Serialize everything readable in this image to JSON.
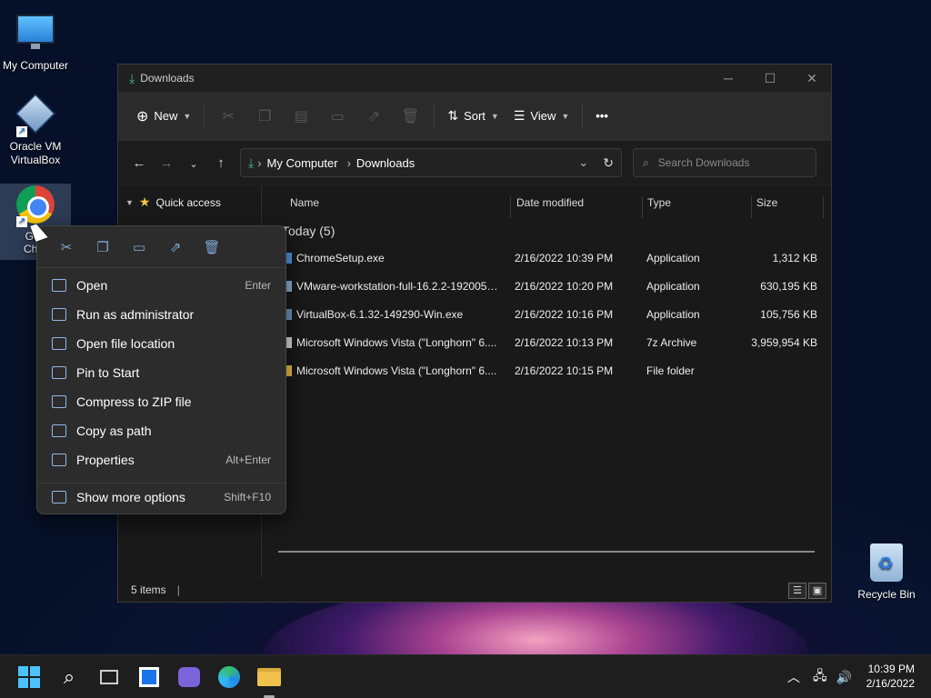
{
  "desktop": {
    "icons": [
      {
        "label": "My Computer"
      },
      {
        "label": "Oracle VM VirtualBox"
      },
      {
        "label": "Google Chrome"
      },
      {
        "label": "Recycle Bin"
      }
    ],
    "chrome_visible_label_1": "Goo",
    "chrome_visible_label_2": "Chro"
  },
  "explorer": {
    "title": "Downloads",
    "toolbar": {
      "new_label": "New",
      "sort_label": "Sort",
      "view_label": "View",
      "more_label": "•••"
    },
    "breadcrumb": [
      "My Computer",
      "Downloads"
    ],
    "search_placeholder": "Search Downloads",
    "nav": {
      "quick_access": "Quick access"
    },
    "columns": {
      "name": "Name",
      "date": "Date modified",
      "type": "Type",
      "size": "Size"
    },
    "group_label": "Today (5)",
    "files": [
      {
        "name": "ChromeSetup.exe",
        "date": "2/16/2022 10:39 PM",
        "type": "Application",
        "size": "1,312 KB",
        "icon_color": "#4f9be8"
      },
      {
        "name": "VMware-workstation-full-16.2.2-1920050...",
        "date": "2/16/2022 10:20 PM",
        "type": "Application",
        "size": "630,195 KB",
        "icon_color": "#8fb3d6"
      },
      {
        "name": "VirtualBox-6.1.32-149290-Win.exe",
        "date": "2/16/2022 10:16 PM",
        "type": "Application",
        "size": "105,756 KB",
        "icon_color": "#6f96c2"
      },
      {
        "name": "Microsoft Windows Vista (\"Longhorn\" 6....",
        "date": "2/16/2022 10:13 PM",
        "type": "7z Archive",
        "size": "3,959,954 KB",
        "icon_color": "#dddddd"
      },
      {
        "name": "Microsoft Windows Vista (\"Longhorn\" 6....",
        "date": "2/16/2022 10:15 PM",
        "type": "File folder",
        "size": "",
        "icon_color": "#f0c14b"
      }
    ],
    "status": "5 items"
  },
  "context_menu": {
    "items": [
      {
        "label": "Open",
        "shortcut": "Enter",
        "icon": "open-icon"
      },
      {
        "label": "Run as administrator",
        "shortcut": "",
        "icon": "shield-icon"
      },
      {
        "label": "Open file location",
        "shortcut": "",
        "icon": "folder-icon"
      },
      {
        "label": "Pin to Start",
        "shortcut": "",
        "icon": "pin-icon"
      },
      {
        "label": "Compress to ZIP file",
        "shortcut": "",
        "icon": "zip-icon"
      },
      {
        "label": "Copy as path",
        "shortcut": "",
        "icon": "copy-path-icon"
      },
      {
        "label": "Properties",
        "shortcut": "Alt+Enter",
        "icon": "properties-icon"
      },
      {
        "label": "Show more options",
        "shortcut": "Shift+F10",
        "icon": "more-options-icon"
      }
    ]
  },
  "taskbar": {
    "time": "10:39 PM",
    "date": "2/16/2022"
  },
  "colors": {
    "accent": "#0078d4",
    "folder": "#f0c14b",
    "download_arrow": "#3fbf7f"
  }
}
